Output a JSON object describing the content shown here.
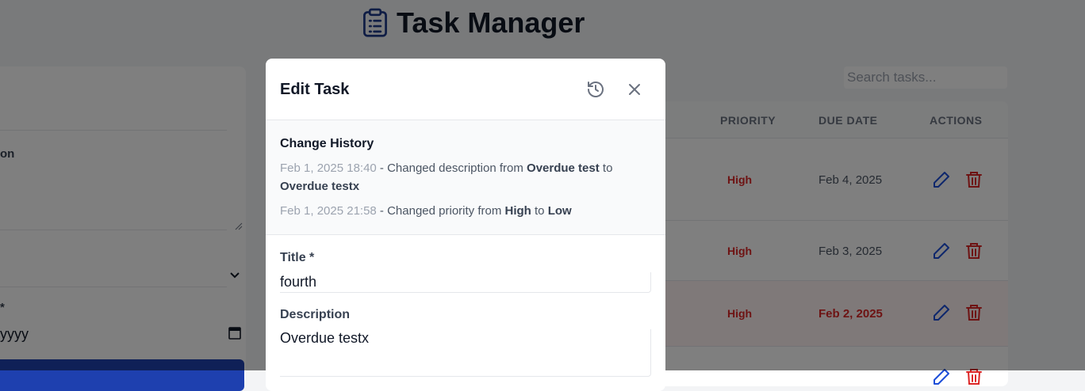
{
  "app": {
    "title": "Task Manager"
  },
  "form": {
    "description_label_fragment": "on",
    "due_label_fragment": "*",
    "due_placeholder_fragment": "yyyy"
  },
  "search": {
    "placeholder": "Search tasks..."
  },
  "table": {
    "headers": {
      "priority": "PRIORITY",
      "due_date": "DUE DATE",
      "actions": "ACTIONS"
    },
    "rows": [
      {
        "priority": "High",
        "due": "Feb 4, 2025",
        "overdue": false
      },
      {
        "priority": "High",
        "due": "Feb 3, 2025",
        "overdue": false
      },
      {
        "priority": "High",
        "due": "Feb 2, 2025",
        "overdue": true
      }
    ]
  },
  "modal": {
    "title": "Edit Task",
    "history": {
      "title": "Change History",
      "entries": [
        {
          "timestamp": "Feb 1, 2025 18:40",
          "text_a": " - Changed description from ",
          "from": "Overdue test",
          "text_b": " to ",
          "to": "Overdue testx"
        },
        {
          "timestamp": "Feb 1, 2025 21:58",
          "text_a": " - Changed priority from ",
          "from": "High",
          "text_b": " to ",
          "to": "Low"
        }
      ]
    },
    "fields": {
      "title_label": "Title *",
      "title_value": "fourth",
      "description_label": "Description",
      "description_value": "Overdue testx"
    }
  },
  "colors": {
    "accent": "#1e40af",
    "priority_high": "#dc2626",
    "edit_icon": "#1d4ed8",
    "delete_icon": "#dc2626"
  }
}
